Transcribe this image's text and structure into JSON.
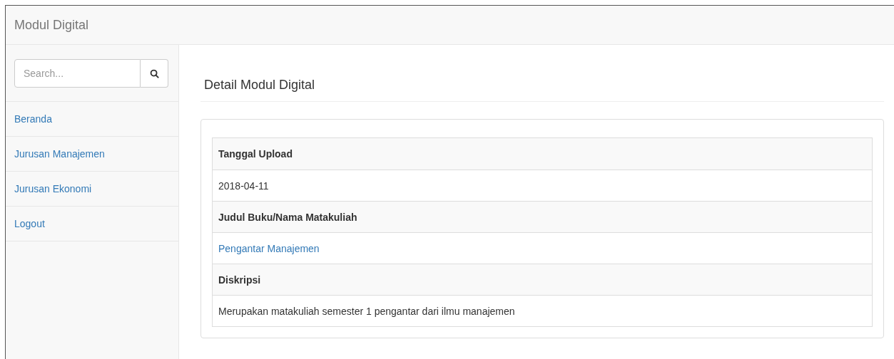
{
  "navbar": {
    "brand": "Modul Digital"
  },
  "sidebar": {
    "search": {
      "placeholder": "Search..."
    },
    "items": [
      {
        "label": "Beranda"
      },
      {
        "label": "Jurusan Manajemen"
      },
      {
        "label": "Jurusan Ekonomi"
      },
      {
        "label": "Logout"
      }
    ]
  },
  "page_title": "Detail Modul Digital",
  "table": {
    "rows": [
      {
        "kind": "heading",
        "text": "Tanggal Upload"
      },
      {
        "kind": "value",
        "text": "2018-04-11"
      },
      {
        "kind": "heading",
        "text": "Judul Buku/Nama Matakuliah"
      },
      {
        "kind": "link",
        "text": "Pengantar Manajemen"
      },
      {
        "kind": "heading",
        "text": "Diskripsi"
      },
      {
        "kind": "value",
        "text": "Merupakan matakuliah semester 1 pengantar dari ilmu manajemen"
      }
    ]
  }
}
